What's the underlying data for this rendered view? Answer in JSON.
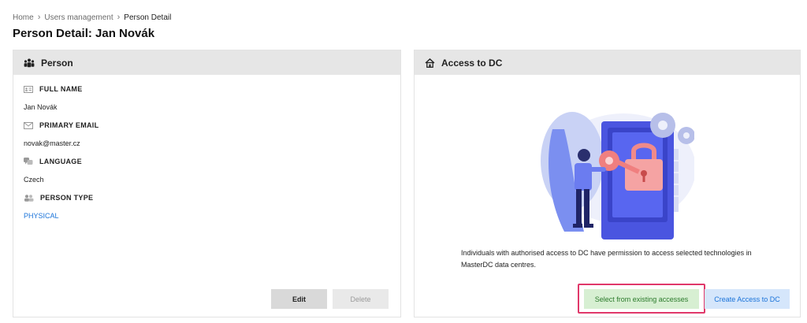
{
  "breadcrumb": {
    "home": "Home",
    "users": "Users management",
    "current": "Person Detail"
  },
  "page_title": "Person Detail: Jan Novák",
  "person_card": {
    "title": "Person",
    "title_icon": "group-icon",
    "fields": [
      {
        "icon": "id-card-icon",
        "label": "FULL NAME",
        "value": "Jan Novák"
      },
      {
        "icon": "envelope-icon",
        "label": "PRIMARY EMAIL",
        "value": "novak@master.cz"
      },
      {
        "icon": "language-icon",
        "label": "LANGUAGE",
        "value": "Czech"
      },
      {
        "icon": "person-type-icon",
        "label": "PERSON TYPE",
        "value": "PHYSICAL"
      }
    ],
    "edit_label": "Edit",
    "delete_label": "Delete"
  },
  "access_card": {
    "title": "Access to DC",
    "title_icon": "house-icon",
    "illustration": "person-with-key-and-padlock-illustration",
    "description": "Individuals with authorised access to DC have permission to access selected technologies in MasterDC data centres.",
    "select_label": "Select from existing accesses",
    "create_label": "Create Access to DC"
  },
  "colors": {
    "header_bg": "#e6e6e6",
    "link": "#1a73d9",
    "highlight": "#e0386a",
    "select_bg": "#d7efd2",
    "create_bg": "#d5e6fb"
  }
}
